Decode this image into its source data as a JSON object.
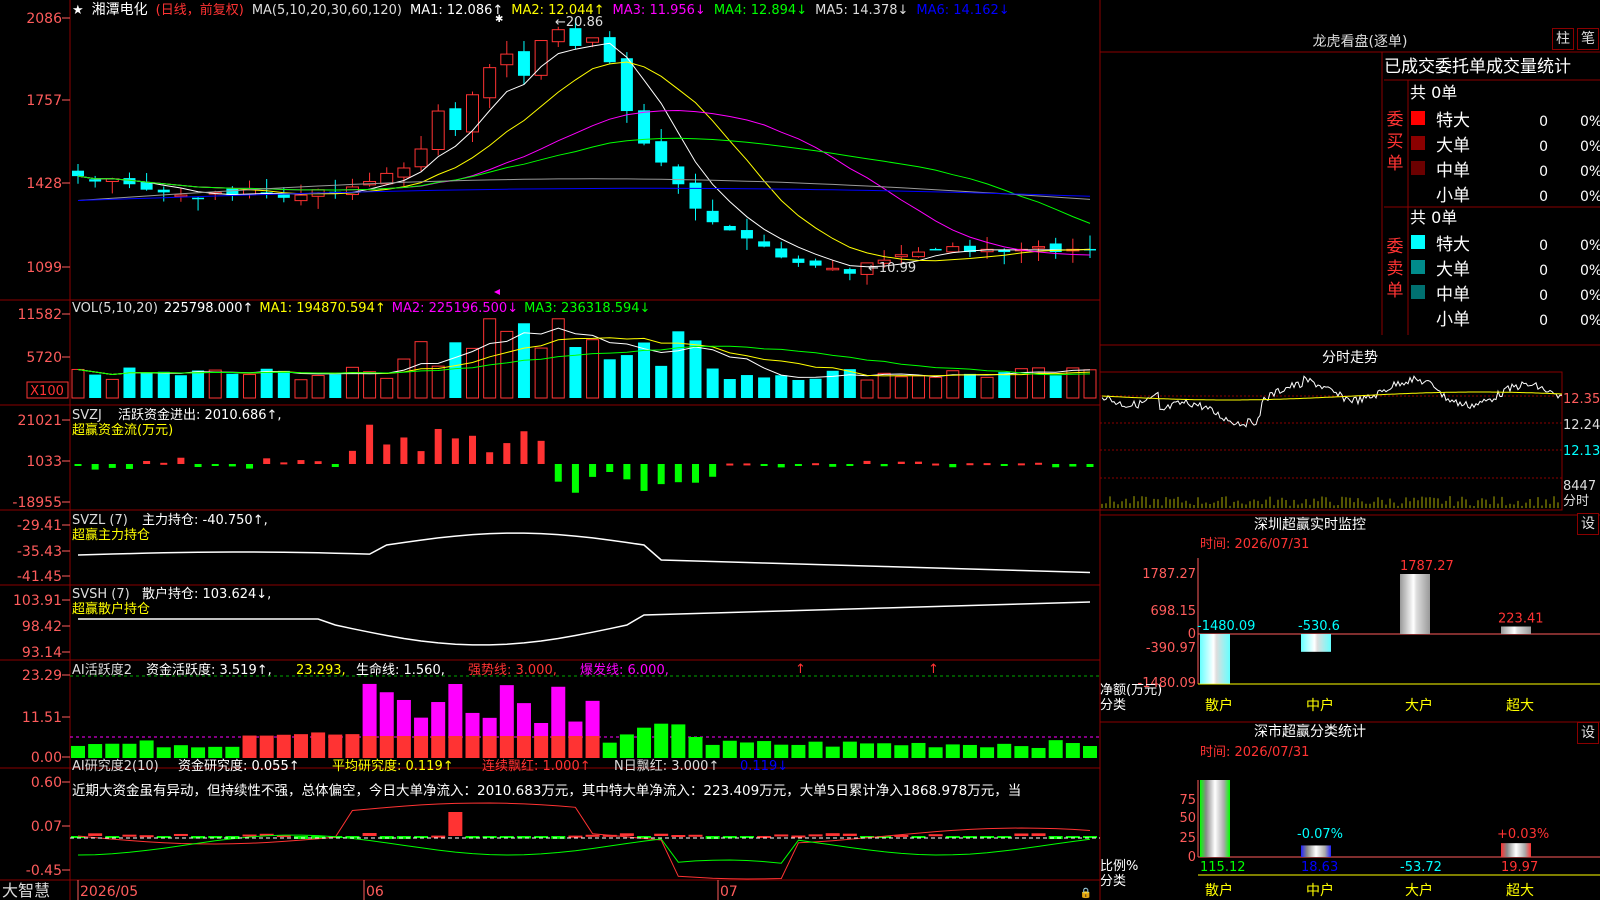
{
  "stock": {
    "name": "湘潭电化",
    "star": "★",
    "mode": "(日线，前复权)",
    "ma_header": "MA(5,10,20,30,60,120)",
    "ma1": "MA1: 12.086↑",
    "ma2": "MA2: 12.044↑",
    "ma3": "MA3: 11.956↓",
    "ma4": "MA4: 12.894↓",
    "ma5": "MA5: 14.378↓",
    "ma6": "MA6: 14.162↓",
    "hi_label": "20.86",
    "lo_label": "10.99",
    "yticks": [
      "2086",
      "1757",
      "1428",
      "1099"
    ]
  },
  "vol": {
    "header": "VOL(5,10,20)",
    "value": "225798.000↑",
    "ma1": "MA1: 194870.594↑",
    "ma2": "MA2: 225196.500↓",
    "ma3": "MA3: 236318.594↓",
    "yticks": [
      "11582",
      "5720",
      "X100"
    ]
  },
  "svzj": {
    "header": "SVZJ",
    "title": "活跃资金进出: 2010.686↑,",
    "subtitle": "超赢资金流(万元)",
    "yticks": [
      "21021",
      "1033",
      "-18955"
    ]
  },
  "svzl": {
    "header": "SVZL  (7)",
    "title": "主力持仓: -40.750↑,",
    "subtitle": "超赢主力持仓",
    "yticks": [
      "-29.41",
      "-35.43",
      "-41.45"
    ]
  },
  "svsh": {
    "header": "SVSH  (7)",
    "title": "散户持仓: 103.624↓,",
    "subtitle": "超赢散户持仓",
    "yticks": [
      "103.91",
      "98.42",
      "93.14"
    ]
  },
  "ai1": {
    "header": "AI活跃度2",
    "title": "资金活跃度: 3.519↑,",
    "v2": "23.293,",
    "v3": "生命线: 1.560,",
    "v4": "强势线: 3.000,",
    "v5": "爆发线: 6.000,",
    "yticks": [
      "23.29",
      "11.51",
      "0.00"
    ]
  },
  "ai2": {
    "header": "AI研究度2(10)",
    "title": "资金研究度: 0.055↑",
    "v2": "平均研究度: 0.119↑",
    "v3": "连续飘红: 1.000↑",
    "v4": "N日飘红: 3.000↑",
    "v5": "0.119↓",
    "commentary": "近期大资金虽有异动，但持续性不强，总体偏空，今日大单净流入：2010.683万元，其中特大单净流入：223.409万元，大单5日累计净入1868.978万元，当",
    "yticks": [
      "0.60",
      "0.07",
      "-0.45"
    ]
  },
  "xaxis": {
    "brand": "大智慧",
    "d1": "2026/05",
    "d2": "06",
    "d3": "07"
  },
  "dragon": {
    "title": "龙虎看盘(逐单)",
    "btn1": "柱",
    "btn2": "笔",
    "header": "已成交委托单成交量统计",
    "buy_label": "委买单",
    "sell_label": "委卖单",
    "buy_total": "共 0单",
    "sell_total": "共 0单",
    "buy_rows": [
      {
        "label": "特大",
        "count": "0",
        "pct": "0%",
        "color": "#ff0000"
      },
      {
        "label": "大单",
        "count": "0",
        "pct": "0%",
        "color": "#8b0000"
      },
      {
        "label": "中单",
        "count": "0",
        "pct": "0%",
        "color": "#6b0000"
      },
      {
        "label": "小单",
        "count": "0",
        "pct": "0%",
        "color": ""
      }
    ],
    "sell_rows": [
      {
        "label": "特大",
        "count": "0",
        "pct": "0%",
        "color": "#00ffff"
      },
      {
        "label": "大单",
        "count": "0",
        "pct": "0%",
        "color": "#008b8b"
      },
      {
        "label": "中单",
        "count": "0",
        "pct": "0%",
        "color": "#007070"
      },
      {
        "label": "小单",
        "count": "0",
        "pct": "0%",
        "color": ""
      }
    ]
  },
  "intraday": {
    "title": "分时走势",
    "yticks": [
      "12.35",
      "12.24",
      "12.13"
    ],
    "vol_label": "8447",
    "vol_unit": "分时"
  },
  "monitor": {
    "title": "深圳超赢实时监控",
    "btn": "设",
    "time": "时间: 2026/07/31",
    "yticks": [
      "1787.27",
      "698.15",
      "0",
      "-390.97",
      "-1480.09"
    ],
    "ylabel1": "净额(万元)",
    "ylabel2": "分类",
    "categories": [
      "散户",
      "中户",
      "大户",
      "超大"
    ],
    "values": [
      -1480.09,
      -530.6,
      1787.27,
      223.41
    ],
    "labels": [
      "-1480.09",
      "-530.6",
      "1787.27",
      "223.41"
    ]
  },
  "classify": {
    "title": "深市超赢分类统计",
    "btn": "设",
    "time": "时间: 2026/07/31",
    "yticks": [
      "75",
      "50",
      "25",
      "0"
    ],
    "ylabel1": "比例%",
    "ylabel2": "分类",
    "categories": [
      "散户",
      "中户",
      "大户",
      "超大"
    ],
    "pct_labels": [
      "",
      "-0.07%",
      "",
      "+0.03%"
    ],
    "bottom_values": [
      "115.12",
      "18.63",
      "-53.72",
      "19.97"
    ],
    "bar_pct": [
      100,
      15,
      0,
      18
    ]
  },
  "colors": {
    "up": "#ff3333",
    "down": "#00ffff",
    "grid": "#8a0000",
    "label": "#ff5c5c",
    "ma1": "#ffffff",
    "ma2": "#ffff00",
    "ma3": "#ff00ff",
    "ma4": "#00ff00",
    "ma5": "#999999",
    "ma6": "#0000ff"
  }
}
